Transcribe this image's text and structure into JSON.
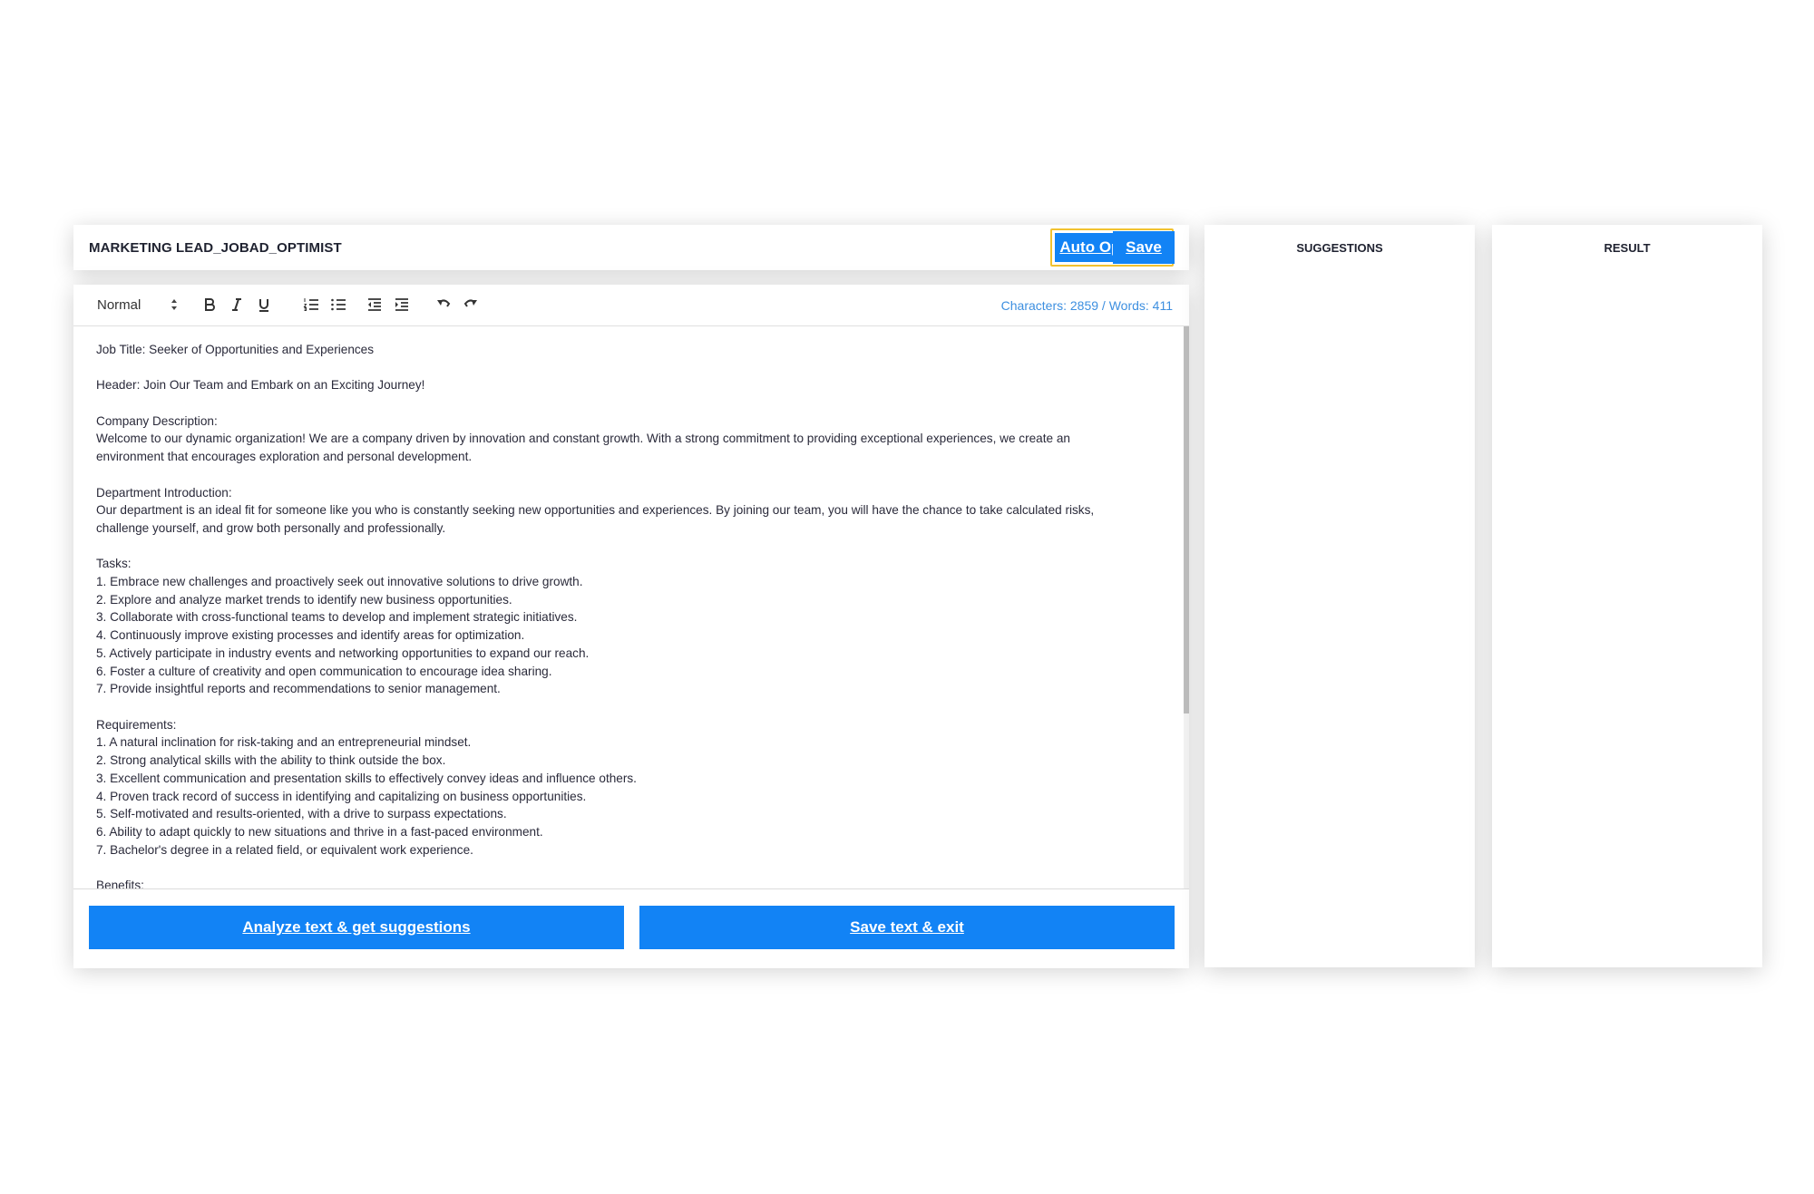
{
  "header": {
    "title": "MARKETING LEAD_JOBAD_OPTIMIST",
    "auto_optimize_label": "Auto Optimize",
    "save_label": "Save"
  },
  "toolbar": {
    "style_value": "Normal",
    "characters_label": "Characters: 2859 / Words: 411",
    "icons": [
      "bold-icon",
      "italic-icon",
      "underline-icon",
      "ordered-list-icon",
      "bullet-list-icon",
      "outdent-icon",
      "indent-icon",
      "undo-icon",
      "redo-icon"
    ]
  },
  "editor": {
    "lines": [
      "Job Title: Seeker of Opportunities and Experiences",
      "",
      "Header: Join Our Team and Embark on an Exciting Journey!",
      "",
      "Company Description:",
      "Welcome to our dynamic organization! We are a company driven by innovation and constant growth. With a strong commitment to providing exceptional experiences, we create an",
      "environment that encourages exploration and personal development.",
      "",
      "Department Introduction:",
      "Our department is an ideal fit for someone like you who is constantly seeking new opportunities and experiences. By joining our team, you will have the chance to take calculated risks,",
      "challenge yourself, and grow both personally and professionally.",
      "",
      "Tasks:",
      "1. Embrace new challenges and proactively seek out innovative solutions to drive growth.",
      "2. Explore and analyze market trends to identify new business opportunities.",
      "3. Collaborate with cross-functional teams to develop and implement strategic initiatives.",
      "4. Continuously improve existing processes and identify areas for optimization.",
      "5. Actively participate in industry events and networking opportunities to expand our reach.",
      "6. Foster a culture of creativity and open communication to encourage idea sharing.",
      "7. Provide insightful reports and recommendations to senior management.",
      "",
      "Requirements:",
      "1. A natural inclination for risk-taking and an entrepreneurial mindset.",
      "2. Strong analytical skills with the ability to think outside the box.",
      "3. Excellent communication and presentation skills to effectively convey ideas and influence others.",
      "4. Proven track record of success in identifying and capitalizing on business opportunities.",
      "5. Self-motivated and results-oriented, with a drive to surpass expectations.",
      "6. Ability to adapt quickly to new situations and thrive in a fast-paced environment.",
      "7. Bachelor's degree in a related field, or equivalent work experience.",
      "",
      "Benefits:"
    ]
  },
  "actions": {
    "analyze_label": "Analyze text & get suggestions",
    "save_exit_label": "Save text & exit"
  },
  "panels": {
    "suggestions_title": "SUGGESTIONS",
    "result_title": "RESULT"
  },
  "colors": {
    "primary": "#1283f5",
    "highlight": "#f2c230",
    "counter": "#3d8fe0"
  }
}
